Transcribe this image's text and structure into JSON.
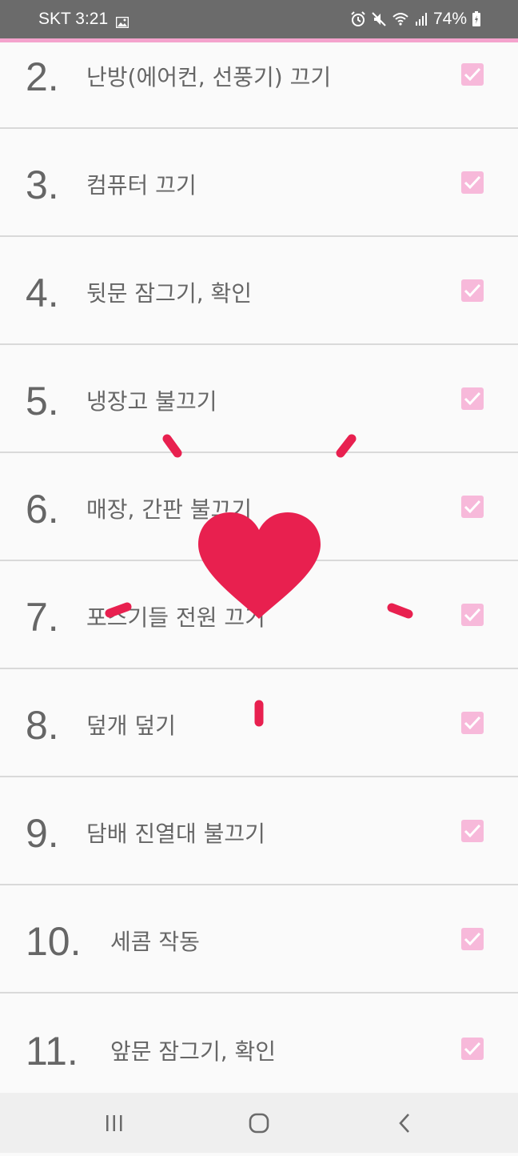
{
  "status_bar": {
    "carrier_time": "SKT 3:21",
    "battery_percent": "74%",
    "icons": [
      "image-icon",
      "alarm-icon",
      "mute-icon",
      "wifi-icon",
      "signal-icon",
      "battery-charging-icon"
    ]
  },
  "accent_color": "#f7b9da",
  "heart_color": "#e8204f",
  "checklist": [
    {
      "number": "2.",
      "label": "난방(에어컨, 선풍기) 끄기",
      "checked": true
    },
    {
      "number": "3.",
      "label": "컴퓨터 끄기",
      "checked": true
    },
    {
      "number": "4.",
      "label": "뒷문 잠그기, 확인",
      "checked": true
    },
    {
      "number": "5.",
      "label": "냉장고 불끄기",
      "checked": true
    },
    {
      "number": "6.",
      "label": "매장, 간판 불끄기",
      "checked": true
    },
    {
      "number": "7.",
      "label": "포스기들 전원 끄기",
      "checked": true
    },
    {
      "number": "8.",
      "label": "덮개 덮기",
      "checked": true
    },
    {
      "number": "9.",
      "label": "담배 진열대 불끄기",
      "checked": true
    },
    {
      "number": "10.",
      "label": "세콤 작동",
      "checked": true
    },
    {
      "number": "11.",
      "label": "앞문 잠그기, 확인",
      "checked": true
    }
  ],
  "nav_bar": {
    "icons": [
      "recent-apps-icon",
      "home-icon",
      "back-icon"
    ]
  }
}
